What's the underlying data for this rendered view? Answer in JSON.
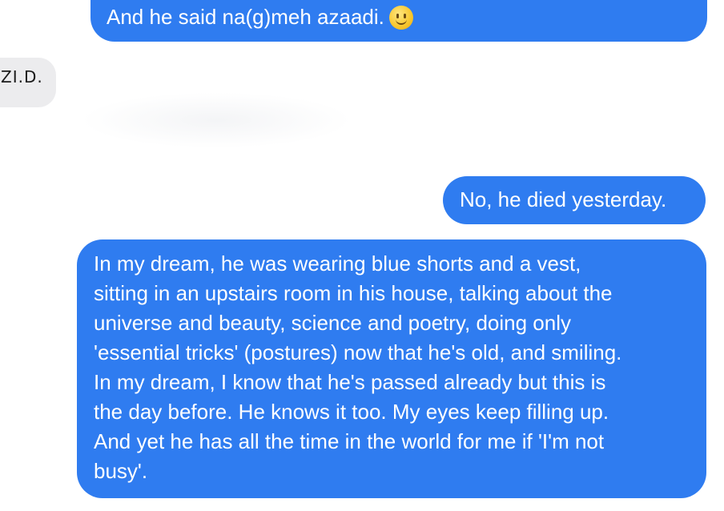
{
  "messages": [
    {
      "id": "sent-1",
      "side": "right",
      "text": "And he said na(g)meh azaadi.",
      "emoji": "slightly-smiling-face-icon"
    },
    {
      "id": "received-1",
      "side": "left",
      "text": "ZI.D."
    },
    {
      "id": "sent-2",
      "side": "right",
      "text": "No, he died yesterday."
    },
    {
      "id": "sent-3",
      "side": "right",
      "lines": [
        "In my dream, he was wearing blue shorts and a vest,",
        "sitting in an upstairs room in his house, talking about the",
        "universe and beauty, science and poetry, doing only",
        "'essential tricks' (postures) now that he's old, and smiling.",
        "In my dream, I know that he's passed already but this is",
        "the day before. He knows it too. My eyes keep filling up.",
        "And yet he has all the time in the world for me if 'I'm not",
        "busy'."
      ]
    }
  ],
  "colors": {
    "sent_bubble": "#2f7cf0",
    "sent_text": "#ffffff",
    "received_bubble": "#ececee",
    "background": "#ffffff"
  }
}
